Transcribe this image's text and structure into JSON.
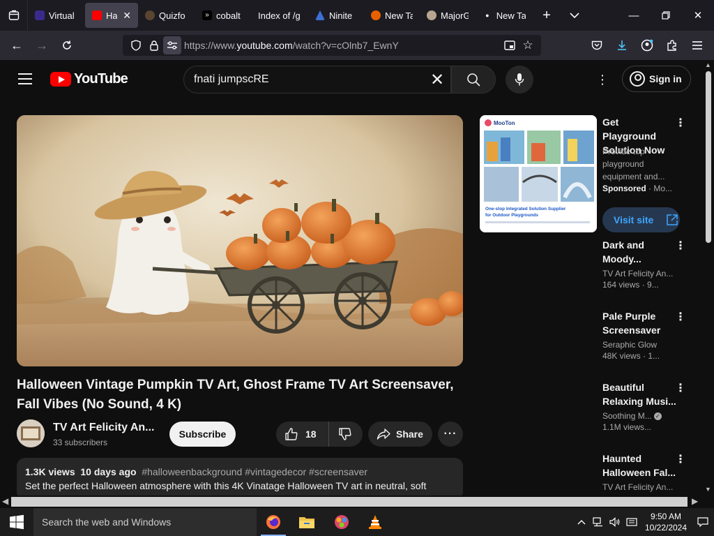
{
  "browser": {
    "tabs": [
      {
        "label": "Virtual",
        "favicon_color": "#3b2a8c",
        "active": false
      },
      {
        "label": "Hall",
        "favicon_color": "#ff0000",
        "active": true
      },
      {
        "label": "Quizfo",
        "favicon_color": "#5a4530",
        "active": false
      },
      {
        "label": "cobalt",
        "favicon_color": "#000000",
        "active": false
      },
      {
        "label": "Index of /g",
        "favicon_color": "#1c1b22",
        "active": false
      },
      {
        "label": "Ninite",
        "favicon_color": "#3d6fd6",
        "active": false
      },
      {
        "label": "New Ta",
        "favicon_color": "#e66000",
        "active": false
      },
      {
        "label": "MajorG",
        "favicon_color": "#b8a590",
        "active": false
      },
      {
        "label": "New Ta",
        "favicon_color": "#1c1b22",
        "active": false
      }
    ],
    "url_prefix": "https://www.",
    "url_domain": "youtube.com",
    "url_rest": "/watch?v=cOlnb7_EwnY"
  },
  "youtube": {
    "logo_text": "YouTube",
    "search_query": "fnati jumpscRE",
    "sign_in_label": "Sign in"
  },
  "video": {
    "title": "Halloween Vintage Pumpkin TV Art, Ghost Frame TV Art Screensaver, Fall Vibes (No Sound, 4 K)",
    "channel": "TV Art Felicity An...",
    "subscribers": "33 subscribers",
    "subscribe_label": "Subscribe",
    "likes": "18",
    "share_label": "Share",
    "views": "1.3K views",
    "age": "10 days ago",
    "tags": "#halloweenbackground #vintagedecor #screensaver",
    "description": "Set the perfect Halloween atmosphere with this 4K Vinatage Halloween TV art in neutral, soft"
  },
  "ad": {
    "brand": "MooTon",
    "tagline": "One-stop Integrated Solution Supplier for Outdoor Playgrounds",
    "title": "Get Playground Solution Now",
    "description": "Provide top playground equipment and...",
    "sponsored": "Sponsored",
    "sponsor_rest": " · Mo...",
    "visit_label": "Visit site"
  },
  "recommendations": [
    {
      "title": "Dark and Moody...",
      "channel": "TV Art Felicity An...",
      "meta": "164 views · 9...",
      "verified": false
    },
    {
      "title": "Pale Purple Screensaver",
      "channel": "Seraphic Glow",
      "meta": "48K views · 1...",
      "verified": false
    },
    {
      "title": "Beautiful Relaxing Musi...",
      "channel": "Soothing M...",
      "meta": "1.1M views...",
      "verified": true
    },
    {
      "title": "Haunted Halloween Fal...",
      "channel": "TV Art Felicity An...",
      "meta": "",
      "verified": false
    }
  ],
  "taskbar": {
    "search_placeholder": "Search the web and Windows",
    "time": "9:50 AM",
    "date": "10/22/2024"
  },
  "colors": {
    "youtube_red": "#ff0000",
    "link_blue": "#3ea6ff",
    "page_bg": "#0f0f0f"
  }
}
